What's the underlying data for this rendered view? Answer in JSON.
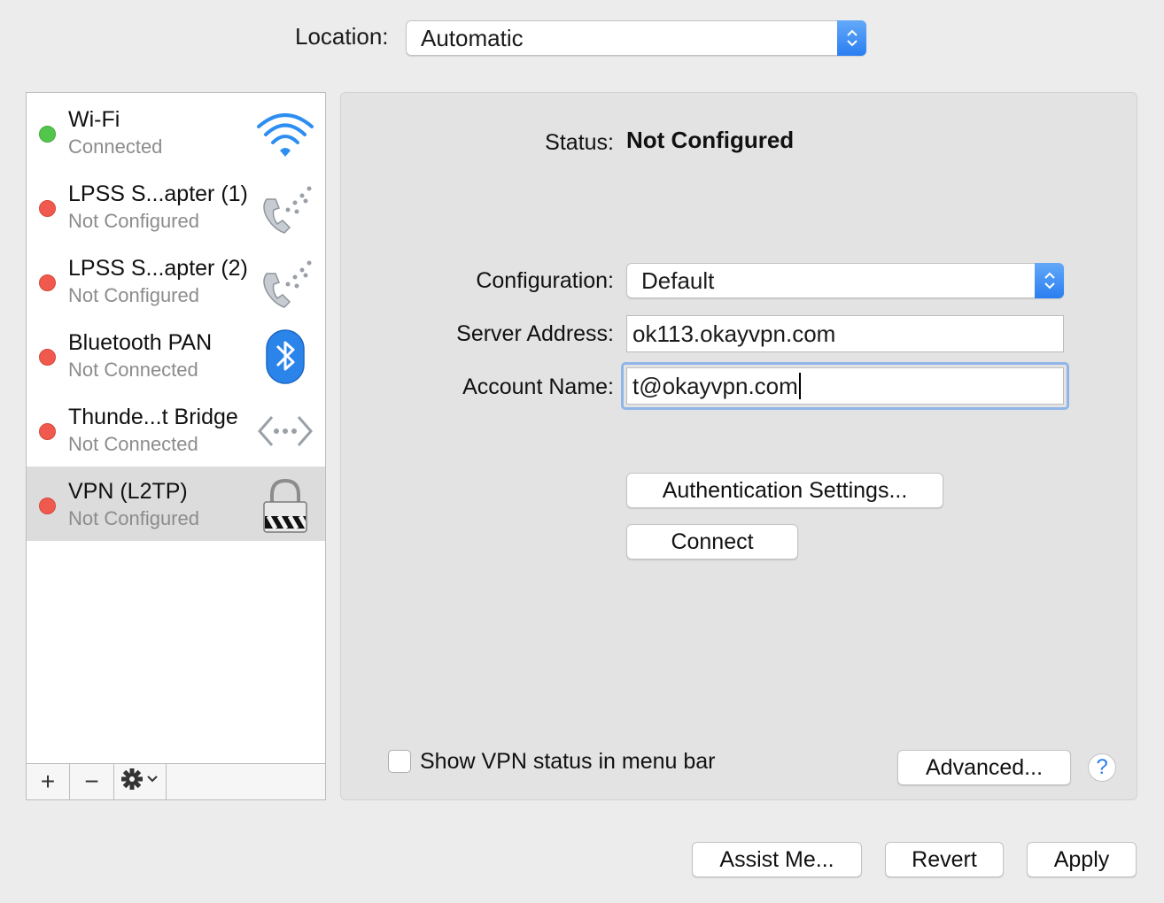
{
  "location": {
    "label": "Location:",
    "value": "Automatic"
  },
  "services": [
    {
      "name": "Wi-Fi",
      "status": "Connected",
      "status_color": "#52c64b",
      "icon": "wifi-icon"
    },
    {
      "name": "LPSS S...apter (1)",
      "status": "Not Configured",
      "status_color": "#f05a4e",
      "icon": "phone-modem-icon"
    },
    {
      "name": "LPSS S...apter (2)",
      "status": "Not Configured",
      "status_color": "#f05a4e",
      "icon": "phone-modem-icon"
    },
    {
      "name": "Bluetooth PAN",
      "status": "Not Connected",
      "status_color": "#f05a4e",
      "icon": "bluetooth-icon"
    },
    {
      "name": "Thunde...t Bridge",
      "status": "Not Connected",
      "status_color": "#f05a4e",
      "icon": "bridge-arrows-icon"
    },
    {
      "name": "VPN (L2TP)",
      "status": "Not Configured",
      "status_color": "#f05a4e",
      "icon": "vpn-lock-icon",
      "selected": true
    }
  ],
  "toolbar": {
    "add": "+",
    "remove": "−",
    "action": "gear-icon"
  },
  "detail": {
    "status_label": "Status:",
    "status_value": "Not Configured",
    "configuration_label": "Configuration:",
    "configuration_value": "Default",
    "server_label": "Server Address:",
    "server_value": "ok113.okayvpn.com",
    "account_label": "Account Name:",
    "account_value": "t@okayvpn.com",
    "auth_button": "Authentication Settings...",
    "connect_button": "Connect",
    "show_status_label": "Show VPN status in menu bar",
    "show_status_checked": false,
    "advanced_button": "Advanced...",
    "help_button": "?"
  },
  "footer": {
    "assist": "Assist Me...",
    "revert": "Revert",
    "apply": "Apply"
  },
  "colors": {
    "accent": "#2a7ef0",
    "focus_ring": "#8fb6e8"
  }
}
